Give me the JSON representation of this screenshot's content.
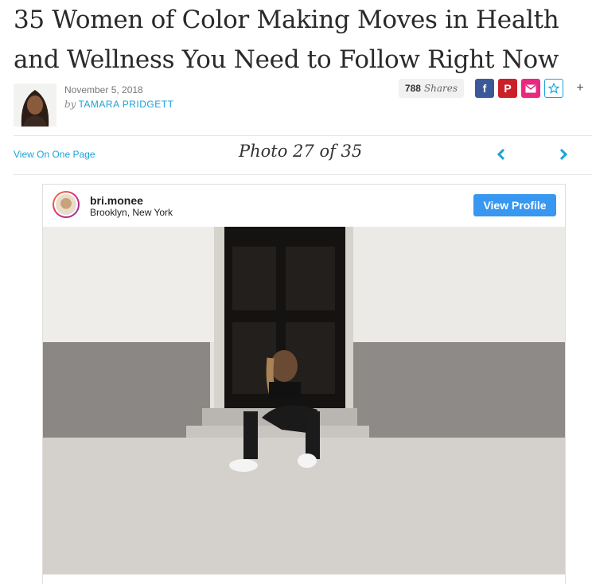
{
  "article": {
    "title": "35 Women of Color Making Moves in Health and Wellness You Need to Follow Right Now",
    "date": "November 5, 2018",
    "by": "by",
    "author": "TAMARA PRIDGETT"
  },
  "share": {
    "count": "788",
    "label": "Shares",
    "icons": [
      "facebook-icon",
      "pinterest-icon",
      "email-icon",
      "star-icon",
      "plus-icon"
    ],
    "colors": {
      "facebook": "#3b5998",
      "pinterest": "#cb2027",
      "email": "#e8297f",
      "accent": "#1aa3d9"
    }
  },
  "gallery": {
    "view_one_page": "View On One Page",
    "photo_counter": "Photo 27 of 35"
  },
  "instagram": {
    "username": "bri.monee",
    "location": "Brooklyn, New York",
    "view_profile": "View Profile",
    "button_color": "#3897f0"
  }
}
